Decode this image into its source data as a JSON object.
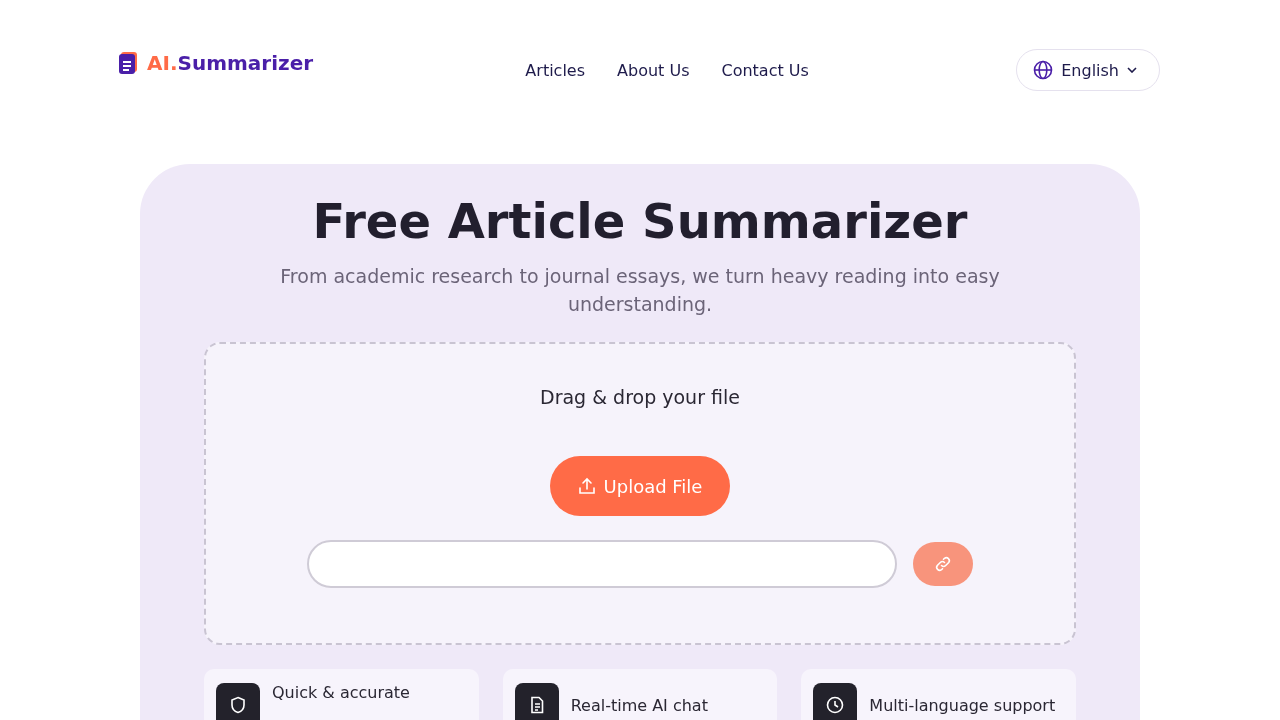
{
  "logo": {
    "prefix": "AI.",
    "name": "Summarizer"
  },
  "nav": [
    {
      "label": "Articles"
    },
    {
      "label": "About Us"
    },
    {
      "label": "Contact Us"
    }
  ],
  "language": {
    "label": "English"
  },
  "hero": {
    "title": "Free Article Summarizer",
    "subtitle": "From academic research to journal essays, we turn heavy reading into easy understanding."
  },
  "dropzone": {
    "prompt": "Drag & drop your file",
    "upload_button": "Upload File",
    "link_button": {
      "disabled": true
    }
  },
  "features": [
    {
      "kind": "shield",
      "label": "Quick & accurate"
    },
    {
      "kind": "document",
      "label": "Real-time AI chat"
    },
    {
      "kind": "clock",
      "label": "Multi-language support"
    }
  ]
}
